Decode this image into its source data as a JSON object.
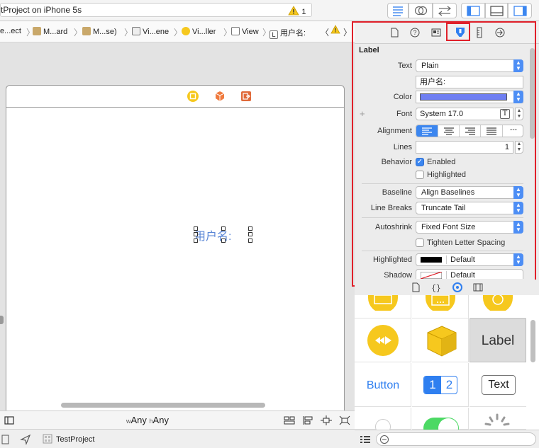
{
  "toolbar": {
    "scheme_title": "tProject on iPhone 5s",
    "warning_count": "1"
  },
  "breadcrumbs": [
    {
      "label": "e...ect"
    },
    {
      "label": "M...ard"
    },
    {
      "label": "M...se)"
    },
    {
      "label": "Vi...ene"
    },
    {
      "label": "Vi...ller"
    },
    {
      "label": "View"
    },
    {
      "label": "用户名:"
    }
  ],
  "canvas": {
    "label_text": "用户名:"
  },
  "size_bar": {
    "w_prefix": "w",
    "w_value": "Any",
    "h_prefix": "h",
    "h_value": "Any"
  },
  "status_bar": {
    "project": "TestProject"
  },
  "inspector": {
    "section_title": "Label",
    "text_label": "Text",
    "text_type": "Plain",
    "text_value": "用户名:",
    "color_label": "Color",
    "color_value": "#6f7ff2",
    "font_label": "Font",
    "font_value": "System 17.0",
    "alignment_label": "Alignment",
    "alignment_justified": "---",
    "lines_label": "Lines",
    "lines_value": "1",
    "behavior_label": "Behavior",
    "enabled_label": "Enabled",
    "highlighted_check_label": "Highlighted",
    "baseline_label": "Baseline",
    "baseline_value": "Align Baselines",
    "linebreaks_label": "Line Breaks",
    "linebreaks_value": "Truncate Tail",
    "autoshrink_label": "Autoshrink",
    "autoshrink_value": "Fixed Font Size",
    "tighten_label": "Tighten Letter Spacing",
    "highlighted_label": "Highlighted",
    "highlighted_value": "Default",
    "shadow_label": "Shadow",
    "shadow_value": "Default"
  },
  "library": {
    "label_item": "Label",
    "button_item": "Button",
    "segment_1": "1",
    "segment_2": "2",
    "text_item": "Text"
  },
  "colors": {
    "accent": "#3b86f0",
    "highlight_box": "#e0202a",
    "scene_label": "#5a86d6",
    "icon_yellow": "#f6c81e"
  }
}
